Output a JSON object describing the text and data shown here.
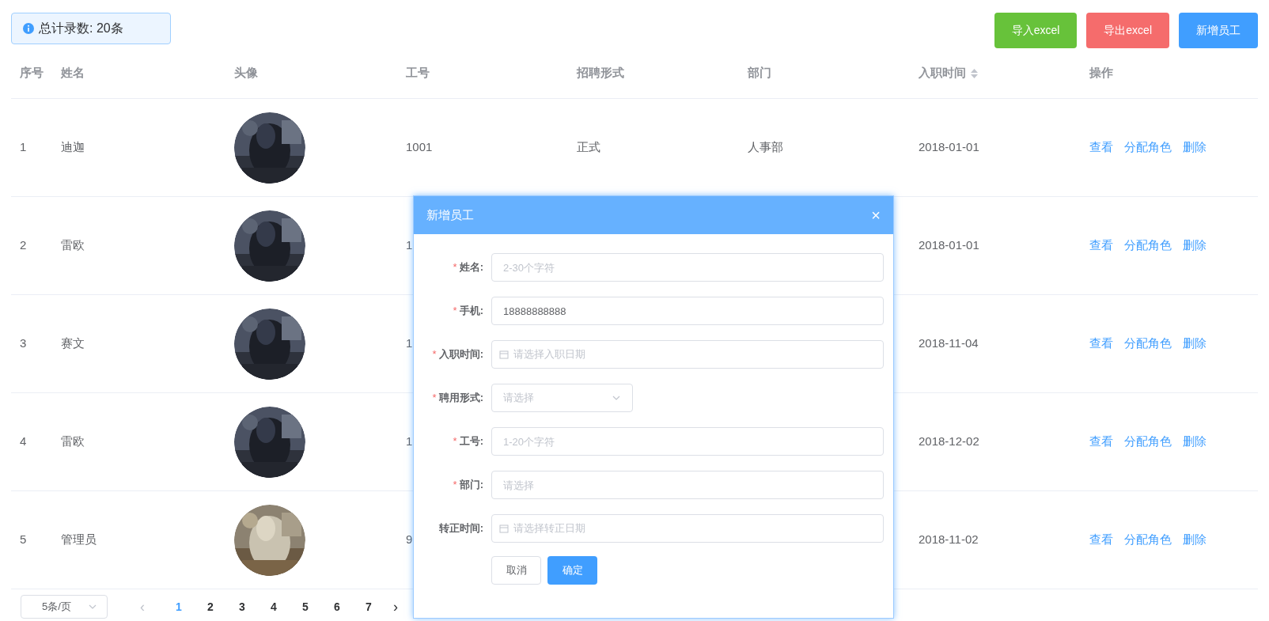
{
  "summary": {
    "text": "总计录数: 20条"
  },
  "actions": [
    {
      "label": "导入excel",
      "kind": "success"
    },
    {
      "label": "导出excel",
      "kind": "danger"
    },
    {
      "label": "新增员工",
      "kind": "primary"
    }
  ],
  "table": {
    "columns": [
      {
        "label": "序号"
      },
      {
        "label": "姓名"
      },
      {
        "label": "头像"
      },
      {
        "label": "工号"
      },
      {
        "label": "招聘形式"
      },
      {
        "label": "部门"
      },
      {
        "label": "入职时间",
        "sortable": true
      },
      {
        "label": "操作"
      }
    ],
    "rows": [
      {
        "index": "1",
        "name": "迪迦",
        "job_number": "1001",
        "hire_form": "正式",
        "department": "人事部",
        "hire_date": "2018-01-01",
        "operations": [
          "查看",
          "分配角色",
          "删除"
        ]
      },
      {
        "index": "2",
        "name": "雷欧",
        "job_number": "1",
        "hire_date": "2018-01-01",
        "operations": [
          "查看",
          "分配角色",
          "删除"
        ]
      },
      {
        "index": "3",
        "name": "赛文",
        "job_number": "1",
        "hire_date": "2018-11-04",
        "operations": [
          "查看",
          "分配角色",
          "删除"
        ]
      },
      {
        "index": "4",
        "name": "雷欧",
        "job_number": "1",
        "hire_date": "2018-12-02",
        "operations": [
          "查看",
          "分配角色",
          "删除"
        ]
      },
      {
        "index": "5",
        "name": "管理员",
        "job_number": "9",
        "hire_date": "2018-11-02",
        "operations": [
          "查看",
          "分配角色",
          "删除"
        ]
      }
    ]
  },
  "pagination": {
    "page_size": "5条/页",
    "prev": "‹",
    "next": "›",
    "pages": [
      {
        "label": "1",
        "selected": true
      },
      {
        "label": "2",
        "selected": false
      },
      {
        "label": "3",
        "selected": false
      },
      {
        "label": "4",
        "selected": false
      },
      {
        "label": "5",
        "selected": false
      },
      {
        "label": "6",
        "selected": false
      },
      {
        "label": "7",
        "selected": false
      }
    ]
  },
  "dialog": {
    "title": "新增员工",
    "close": "×",
    "fields": [
      {
        "label": "姓名:",
        "required_mark": "*",
        "kind": "input",
        "placeholder": "2-30个字符"
      },
      {
        "label": "手机:",
        "required_mark": "*",
        "kind": "input",
        "value": "18888888888"
      },
      {
        "label": "入职时间:",
        "required_mark": "*",
        "kind": "date",
        "placeholder": "请选择入职日期"
      },
      {
        "label": "聘用形式:",
        "required_mark": "*",
        "kind": "select",
        "placeholder": "请选择"
      },
      {
        "label": "工号:",
        "required_mark": "*",
        "kind": "input",
        "placeholder": "1-20个字符"
      },
      {
        "label": "部门:",
        "required_mark": "*",
        "kind": "input",
        "placeholder": "请选择"
      },
      {
        "label": "转正时间:",
        "kind": "date",
        "placeholder": "请选择转正日期"
      }
    ],
    "buttons": [
      {
        "label": "取消",
        "kind": "default"
      },
      {
        "label": "确定",
        "kind": "primary"
      }
    ]
  }
}
